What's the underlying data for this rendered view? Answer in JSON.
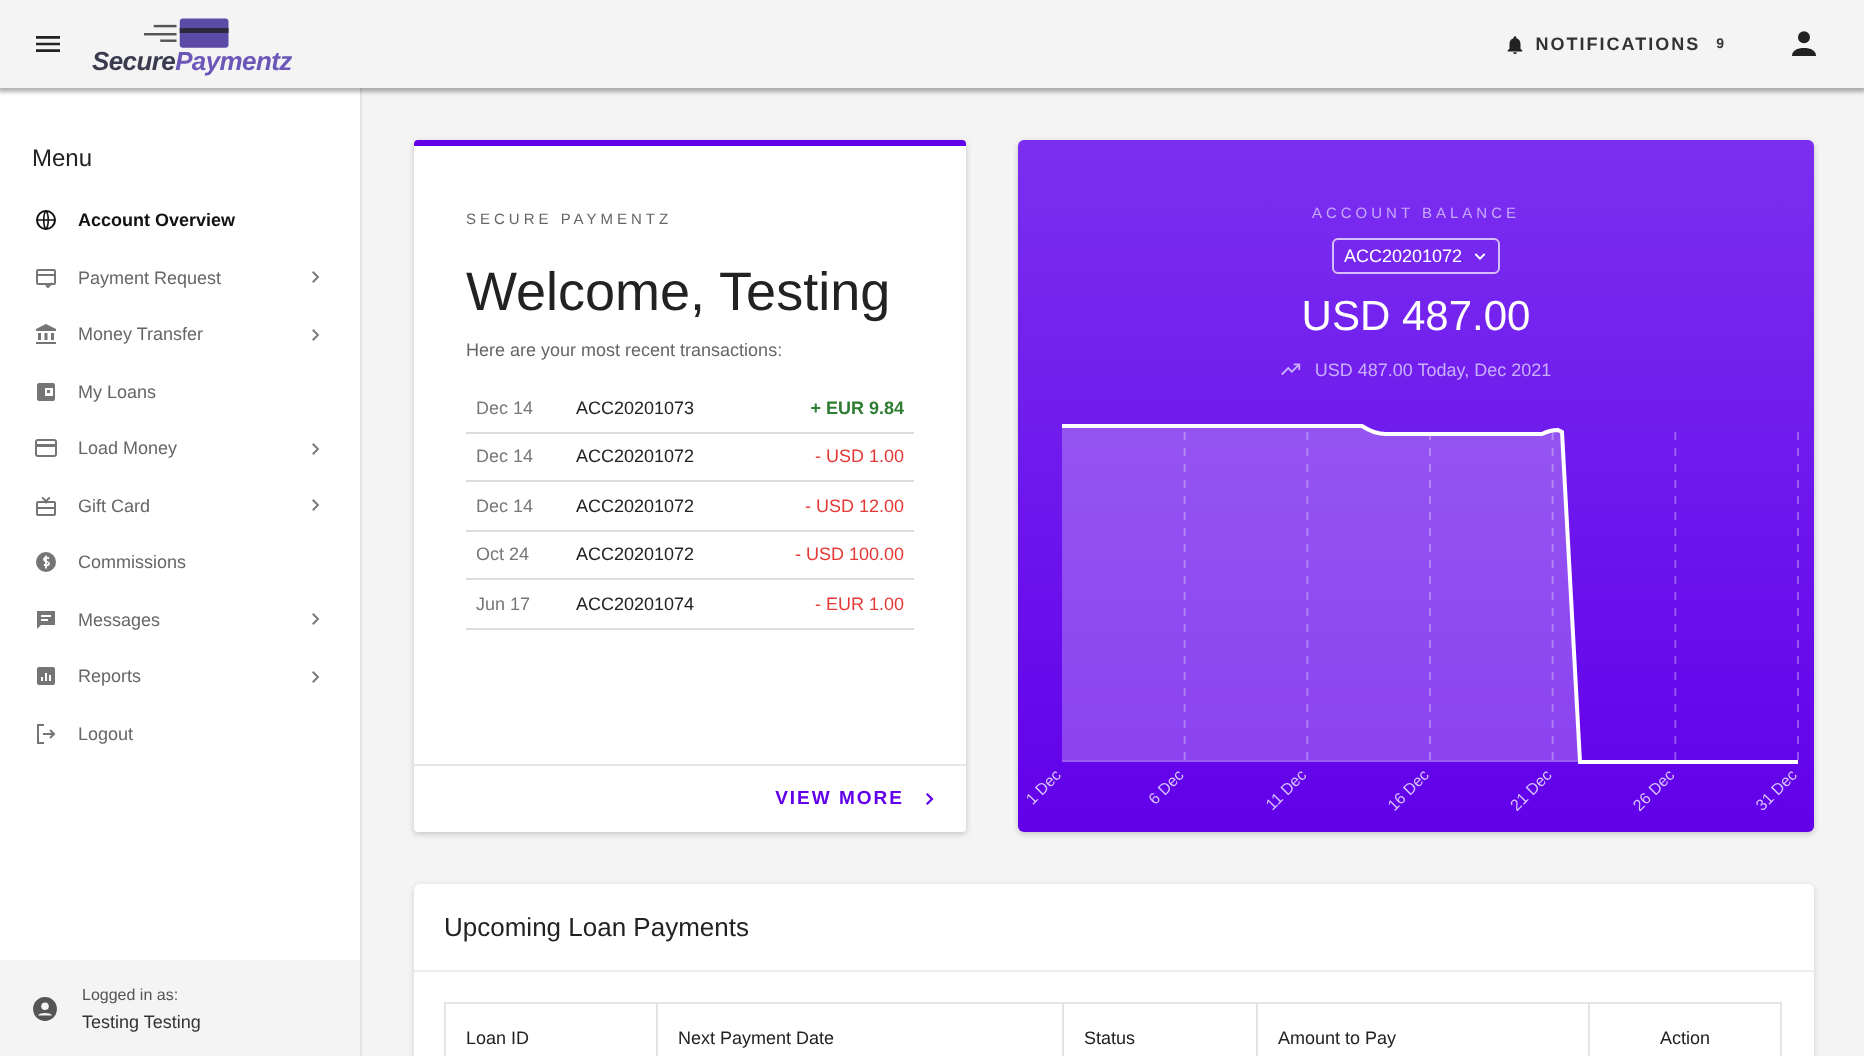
{
  "top_bar": {
    "logo": {
      "first": "Secure",
      "second": "Paymentz"
    },
    "notifications": {
      "label": "NOTIFICATIONS",
      "count": "9"
    }
  },
  "sidebar": {
    "title": "Menu",
    "items": [
      {
        "label": "Account Overview",
        "selected": true,
        "has_submenu": false
      },
      {
        "label": "Payment Request",
        "selected": false,
        "has_submenu": true
      },
      {
        "label": "Money Transfer",
        "selected": false,
        "has_submenu": true
      },
      {
        "label": "My Loans",
        "selected": false,
        "has_submenu": false
      },
      {
        "label": "Load Money",
        "selected": false,
        "has_submenu": true
      },
      {
        "label": "Gift Card",
        "selected": false,
        "has_submenu": true
      },
      {
        "label": "Commissions",
        "selected": false,
        "has_submenu": false
      },
      {
        "label": "Messages",
        "selected": false,
        "has_submenu": true
      },
      {
        "label": "Reports",
        "selected": false,
        "has_submenu": true
      },
      {
        "label": "Logout",
        "selected": false,
        "has_submenu": false
      }
    ],
    "footer": {
      "caption": "Logged in as:",
      "user": "Testing Testing"
    }
  },
  "welcome_card": {
    "overline": "SECURE PAYMENTZ",
    "title": "Welcome, Testing",
    "subtitle": "Here are your most recent transactions:",
    "transactions": [
      {
        "date": "Dec 14",
        "account": "ACC20201073",
        "amount": "+ EUR 9.84",
        "kind": "credit"
      },
      {
        "date": "Dec 14",
        "account": "ACC20201072",
        "amount": "- USD 1.00",
        "kind": "debit"
      },
      {
        "date": "Dec 14",
        "account": "ACC20201072",
        "amount": "- USD 12.00",
        "kind": "debit"
      },
      {
        "date": "Oct 24",
        "account": "ACC20201072",
        "amount": "- USD 100.00",
        "kind": "debit"
      },
      {
        "date": "Jun 17",
        "account": "ACC20201074",
        "amount": "- EUR 1.00",
        "kind": "debit"
      }
    ],
    "action": "VIEW MORE"
  },
  "balance_card": {
    "overline": "ACCOUNT BALANCE",
    "account_select": "ACC20201072",
    "balance": "USD 487.00",
    "trend": "USD 487.00 Today, Dec 2021",
    "x_labels": [
      "1 Dec",
      "6 Dec",
      "11 Dec",
      "16 Dec",
      "21 Dec",
      "26 Dec",
      "31 Dec"
    ]
  },
  "loan_card": {
    "title": "Upcoming Loan Payments",
    "table": {
      "columns": [
        "Loan ID",
        "Next Payment Date",
        "Status",
        "Amount to Pay",
        "Action"
      ]
    }
  }
}
